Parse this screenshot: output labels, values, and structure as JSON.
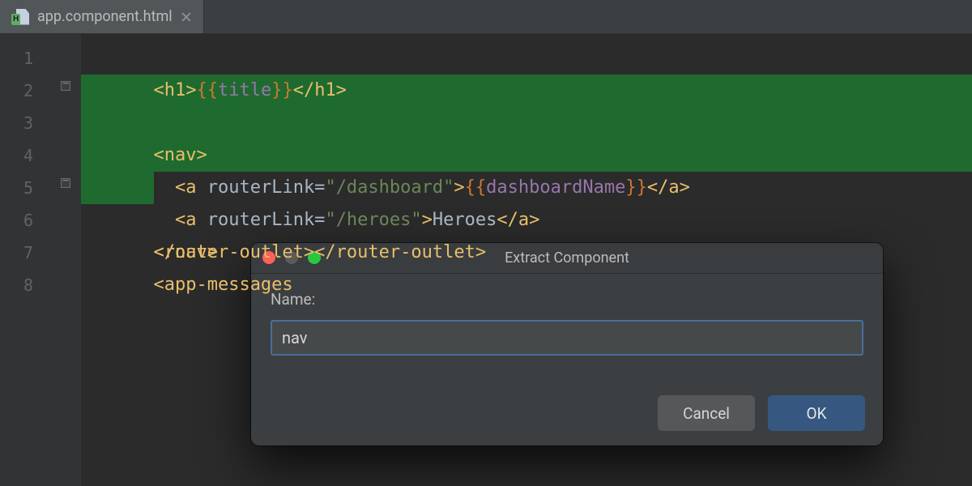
{
  "tab": {
    "filename": "app.component.html",
    "icon_badge": "H"
  },
  "gutter": {
    "lines": [
      "1",
      "2",
      "3",
      "4",
      "5",
      "6",
      "7",
      "8"
    ]
  },
  "code": {
    "l1": {
      "open": "<h1>",
      "exprOpen": "{{",
      "var": "title",
      "exprClose": "}}",
      "close": "</h1>"
    },
    "l2": {
      "open": "<nav>"
    },
    "l3": {
      "open": "<a ",
      "attr": "routerLink=",
      "q1": "\"",
      "str": "/dashboard",
      "q2": "\"",
      "gt": ">",
      "exprOpen": "{{",
      "var": "dashboardName",
      "exprClose": "}}",
      "close": "</a>"
    },
    "l4": {
      "open": "<a ",
      "attr": "routerLink=",
      "q1": "\"",
      "str": "/heroes",
      "q2": "\"",
      "gt": ">",
      "txt": "Heroes",
      "close": "</a>"
    },
    "l5": {
      "close": "</nav>"
    },
    "l6": {
      "open": "<router-outlet>",
      "close": "</router-outlet>"
    },
    "l7": {
      "open": "<app-messages"
    }
  },
  "dialog": {
    "title": "Extract Component",
    "label": "Name:",
    "value": "nav",
    "cancel": "Cancel",
    "ok": "OK"
  }
}
